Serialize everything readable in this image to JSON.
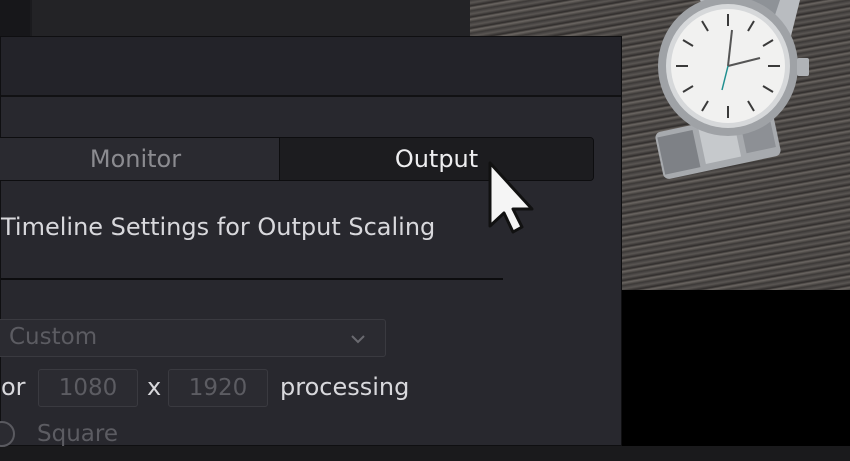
{
  "tabs": [
    {
      "label": "Monitor",
      "active": false
    },
    {
      "label": "Output",
      "active": true
    }
  ],
  "section_title": "Timeline Settings for Output Scaling",
  "resolution_select": {
    "value": "Custom"
  },
  "resolution": {
    "prefix": "or",
    "width": "1080",
    "separator": "x",
    "height": "1920",
    "suffix": "processing"
  },
  "pixel_aspect": {
    "option_label": "Square"
  },
  "icons": {
    "dropdown": "chevron-down-icon",
    "cursor": "mouse-pointer-icon"
  },
  "colors": {
    "dialog_bg": "#28282e",
    "active_tab_text": "#eeeef0",
    "disabled_text": "#5c5c62"
  }
}
